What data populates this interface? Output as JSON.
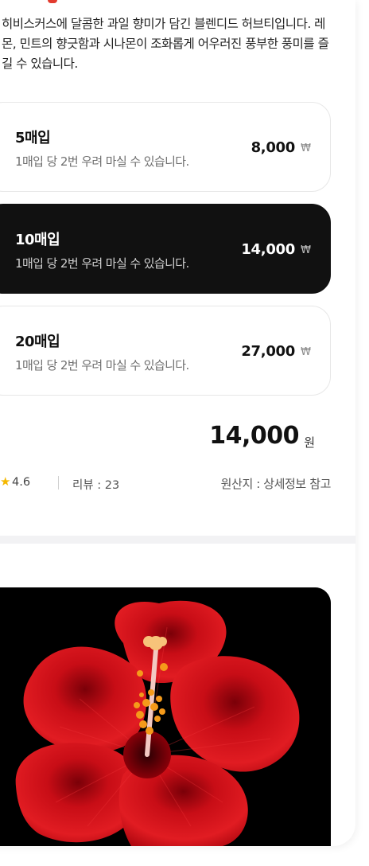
{
  "product": {
    "description": "히비스커스에 달콤한 과일 향미가 담긴 블렌디드 허브티입니다. 레몬, 민트의 향긋함과 시나몬이 조화롭게 어우러진 풍부한 풍미를 즐길 수 있습니다."
  },
  "options": [
    {
      "title": "5매입",
      "subtitle": "1매입 당 2번 우려 마실 수 있습니다.",
      "price": "8,000",
      "currency": "₩",
      "selected": false
    },
    {
      "title": "10매입",
      "subtitle": "1매입 당 2번 우려 마실 수 있습니다.",
      "price": "14,000",
      "currency": "₩",
      "selected": true
    },
    {
      "title": "20매입",
      "subtitle": "1매입 당 2번 우려 마실 수 있습니다.",
      "price": "27,000",
      "currency": "₩",
      "selected": false
    }
  ],
  "total": {
    "amount": "14,000",
    "unit": "원"
  },
  "meta": {
    "rating": "4.6",
    "review": "리뷰 : 23",
    "origin": "원산지 : 상세정보 참고"
  },
  "icons": {
    "rating": "star-icon"
  },
  "colors": {
    "accent": "#111111",
    "star": "#f5b800",
    "flower": "#d4101a"
  }
}
